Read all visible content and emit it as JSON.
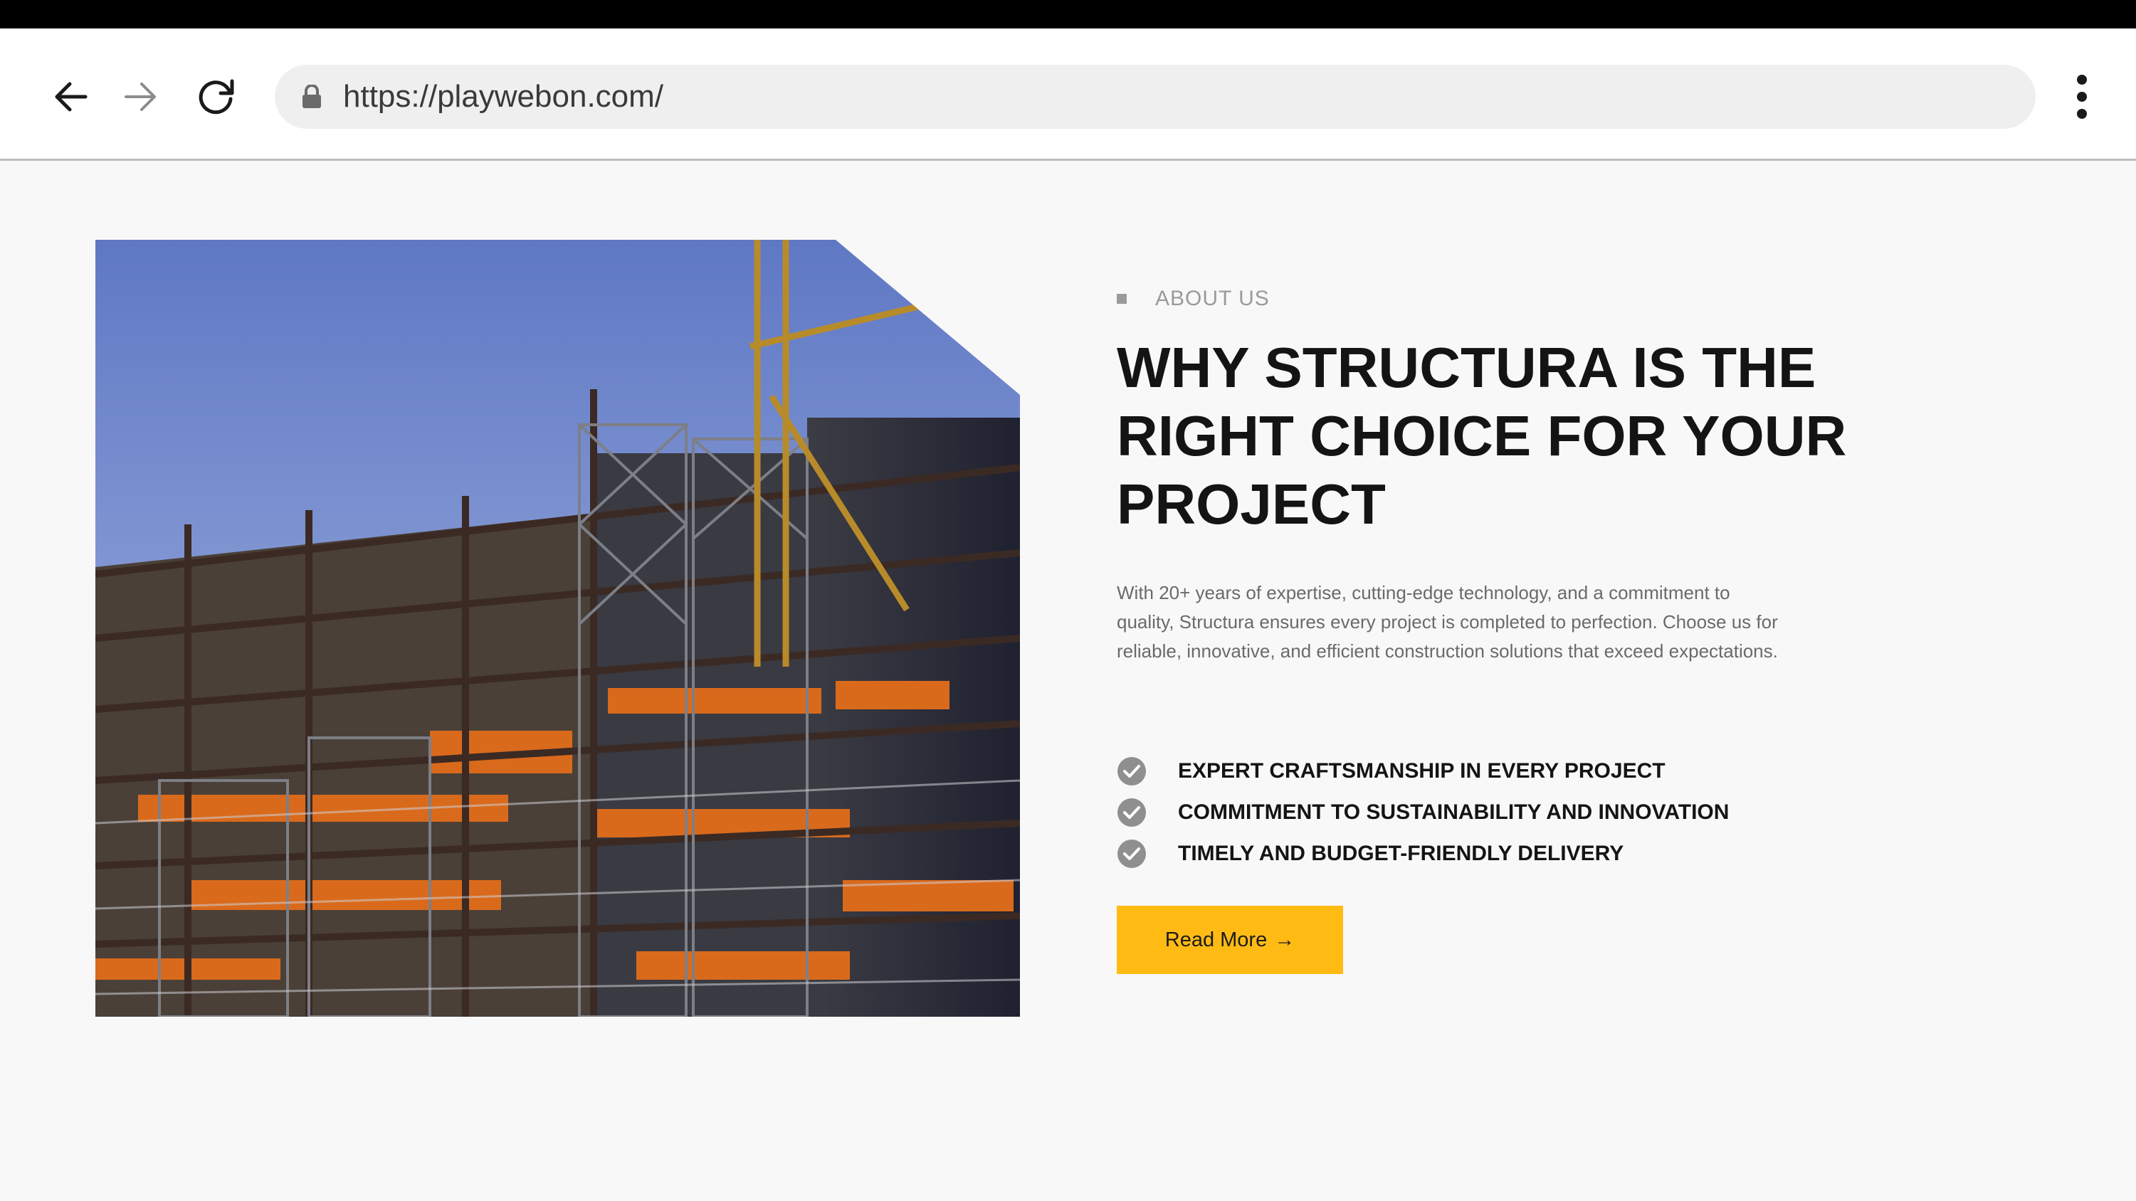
{
  "browser": {
    "url": "https://playwebon.com/"
  },
  "about": {
    "eyebrow": "ABOUT US",
    "headline_lines": [
      "WHY STRUCTURA IS THE",
      "RIGHT CHOICE FOR YOUR",
      "PROJECT"
    ],
    "body": "With 20+ years of expertise, cutting-edge technology, and a commitment to quality, Structura ensures every project is completed to perfection. Choose us for reliable, innovative, and efficient construction solutions that exceed expectations.",
    "features": [
      "EXPERT CRAFTSMANSHIP IN EVERY PROJECT",
      "COMMITMENT TO SUSTAINABILITY AND INNOVATION",
      "TIMELY AND BUDGET-FRIENDLY DELIVERY"
    ],
    "cta_label": "Read More",
    "cta_arrow": "→"
  },
  "colors": {
    "accent": "#ffbb14",
    "heading": "#141414",
    "muted": "#9a9a9a",
    "background": "#f8f8f8"
  },
  "icons": {
    "back": "arrow-left-icon",
    "forward": "arrow-right-icon",
    "reload": "reload-icon",
    "lock": "lock-icon",
    "menu": "more-vert-icon",
    "check": "check-circle-icon"
  }
}
